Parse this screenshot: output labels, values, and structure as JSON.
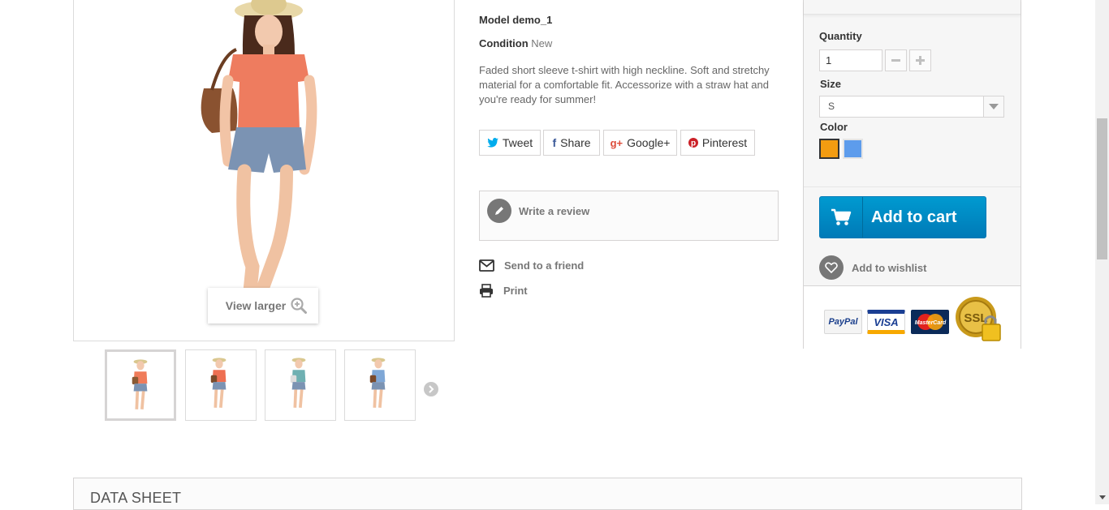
{
  "product": {
    "model_label": "Model",
    "model_value": "demo_1",
    "condition_label": "Condition",
    "condition_value": "New",
    "description": "Faded short sleeve t-shirt with high neckline. Soft and stretchy material for a comfortable fit. Accessorize with a straw hat and you're ready for summer!"
  },
  "image": {
    "view_larger": "View larger"
  },
  "thumbnails": [
    {
      "shirt": "#f07c5a",
      "bag": "#8a5a34"
    },
    {
      "shirt": "#ee6f52",
      "bag": "#7b4a2a"
    },
    {
      "shirt": "#6fb0b2",
      "bag": "#dddddd"
    },
    {
      "shirt": "#7fa7d6",
      "bag": "#7b4a2a"
    }
  ],
  "share": {
    "tweet": "Tweet",
    "share": "Share",
    "google": "Google+",
    "pinterest": "Pinterest"
  },
  "actions": {
    "write_review": "Write a review",
    "send_friend": "Send to a friend",
    "print": "Print"
  },
  "buy": {
    "quantity_label": "Quantity",
    "quantity_value": "1",
    "size_label": "Size",
    "size_value": "S",
    "color_label": "Color",
    "colors": [
      "#f39c11",
      "#5d9cec"
    ],
    "add_to_cart": "Add to cart",
    "add_to_wishlist": "Add to wishlist"
  },
  "payment": {
    "paypal": "PayPal",
    "visa": "VISA",
    "mastercard": "MasterCard",
    "ssl": "SSL"
  },
  "sections": {
    "data_sheet": "DATA SHEET"
  },
  "colors": {
    "accent_blue": "#009ad0",
    "border": "#d6d4d4",
    "text_muted": "#777777"
  }
}
